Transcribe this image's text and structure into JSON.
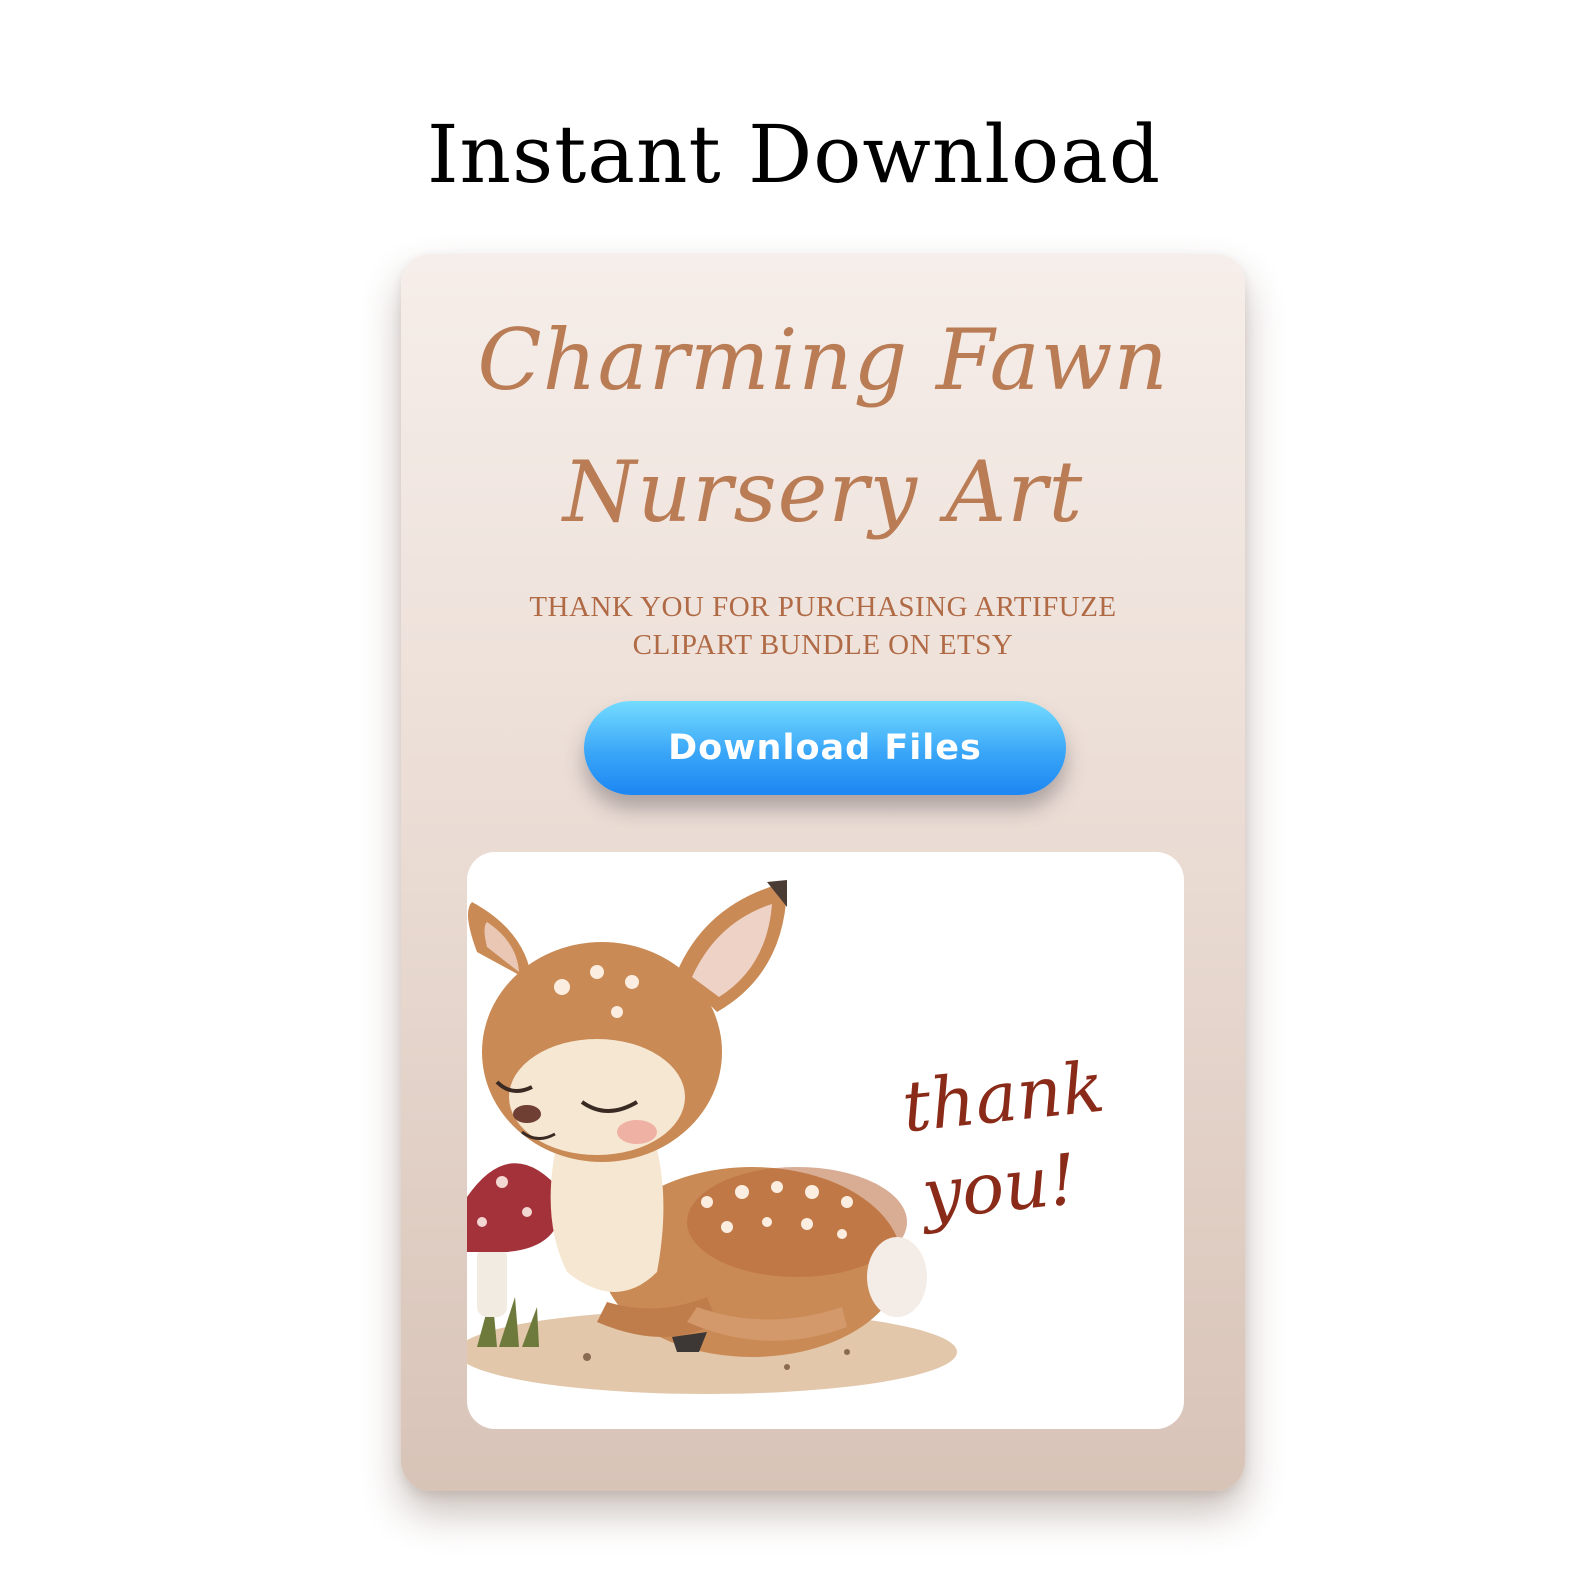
{
  "page": {
    "heading": "Instant Download"
  },
  "card": {
    "title_line1": "Charming Fawn",
    "title_line2": "Nursery Art",
    "subtitle_line1": "THANK YOU FOR PURCHASING ARTIFUZE",
    "subtitle_line2": "CLIPART BUNDLE ON ETSY",
    "button_label": "Download Files"
  },
  "illustration": {
    "subject": "fawn-with-mushroom-illustration",
    "thanks_line1": "thank",
    "thanks_line2": "you!"
  },
  "colors": {
    "title": "#b97c55",
    "subtitle": "#b06a45",
    "button_top": "#74dcff",
    "button_bottom": "#1c86f2",
    "thanks": "#8a2a18",
    "card_top": "#f6eeea",
    "card_bottom": "#d8c3b7"
  }
}
